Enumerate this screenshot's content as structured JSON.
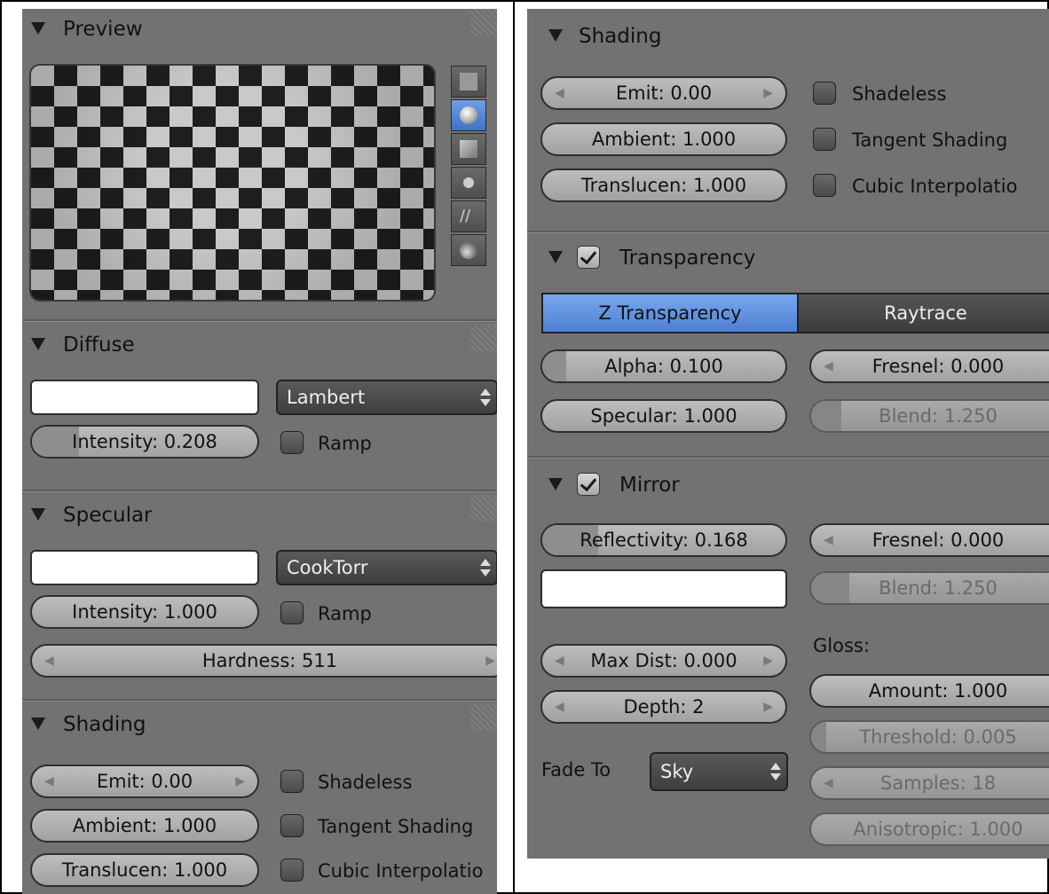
{
  "left": {
    "preview": {
      "title": "Preview"
    },
    "diffuse": {
      "title": "Diffuse",
      "shader": "Lambert",
      "intensity": "Intensity: 0.208",
      "intensity_value": 0.208,
      "ramp": "Ramp"
    },
    "specular": {
      "title": "Specular",
      "shader": "CookTorr",
      "intensity": "Intensity: 1.000",
      "intensity_value": 1.0,
      "ramp": "Ramp",
      "hardness": "Hardness: 511"
    },
    "shading": {
      "title": "Shading",
      "emit": "Emit: 0.00",
      "ambient": "Ambient: 1.000",
      "translucency": "Translucen: 1.000",
      "shadeless": "Shadeless",
      "tangent": "Tangent Shading",
      "cubic": "Cubic Interpolatio"
    }
  },
  "right": {
    "shading": {
      "title": "Shading",
      "emit": "Emit: 0.00",
      "ambient": "Ambient: 1.000",
      "translucency": "Translucen: 1.000",
      "shadeless": "Shadeless",
      "tangent": "Tangent Shading",
      "cubic": "Cubic Interpolatio"
    },
    "transparency": {
      "title": "Transparency",
      "z": "Z Transparency",
      "ray": "Raytrace",
      "alpha": "Alpha: 0.100",
      "alpha_value": 0.1,
      "specular": "Specular: 1.000",
      "fresnel": "Fresnel: 0.000",
      "blend": "Blend: 1.250"
    },
    "mirror": {
      "title": "Mirror",
      "reflectivity": "Reflectivity: 0.168",
      "reflectivity_value": 0.168,
      "fresnel": "Fresnel: 0.000",
      "blend": "Blend: 1.250",
      "maxdist": "Max Dist: 0.000",
      "depth": "Depth: 2",
      "fade_label": "Fade To",
      "fade_value": "Sky",
      "gloss": "Gloss:",
      "amount": "Amount: 1.000",
      "threshold": "Threshold: 0.005",
      "samples": "Samples: 18",
      "anisotropic": "Anisotropic: 1.000"
    }
  }
}
